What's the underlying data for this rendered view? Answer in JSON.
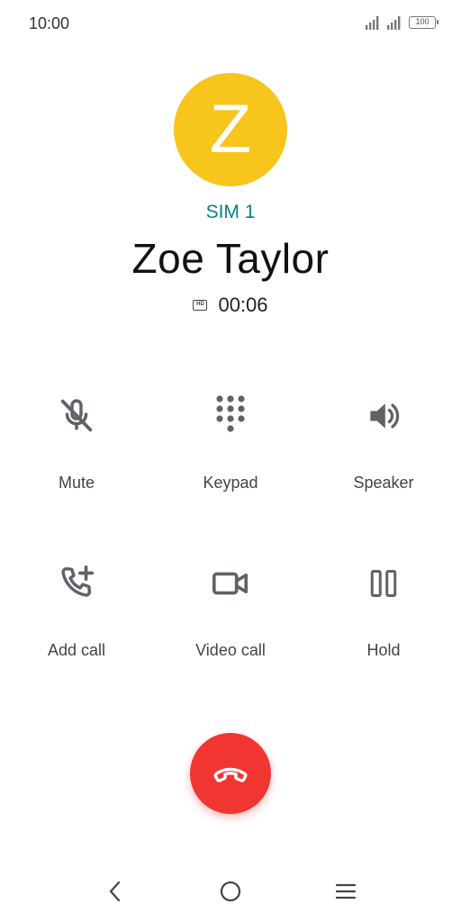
{
  "status_bar": {
    "time": "10:00",
    "battery": "100"
  },
  "caller": {
    "initial": "Z",
    "avatar_color": "#F7C51B",
    "sim": "SIM 1",
    "name": "Zoe Taylor",
    "hd_badge": "HD",
    "duration": "00:06"
  },
  "controls": [
    {
      "label": "Mute",
      "icon": "mic-off-icon"
    },
    {
      "label": "Keypad",
      "icon": "dialpad-icon"
    },
    {
      "label": "Speaker",
      "icon": "speaker-icon"
    },
    {
      "label": "Add call",
      "icon": "add-call-icon"
    },
    {
      "label": "Video call",
      "icon": "video-camera-icon"
    },
    {
      "label": "Hold",
      "icon": "pause-icon"
    }
  ],
  "end_call": {
    "icon": "call-end-icon",
    "color": "#F13632"
  },
  "nav": {
    "back_icon": "back-chevron-icon",
    "home_icon": "home-circle-icon",
    "menu_icon": "menu-lines-icon"
  },
  "colors": {
    "accent": "#0D7E86",
    "icon_gray": "#5F6368"
  }
}
